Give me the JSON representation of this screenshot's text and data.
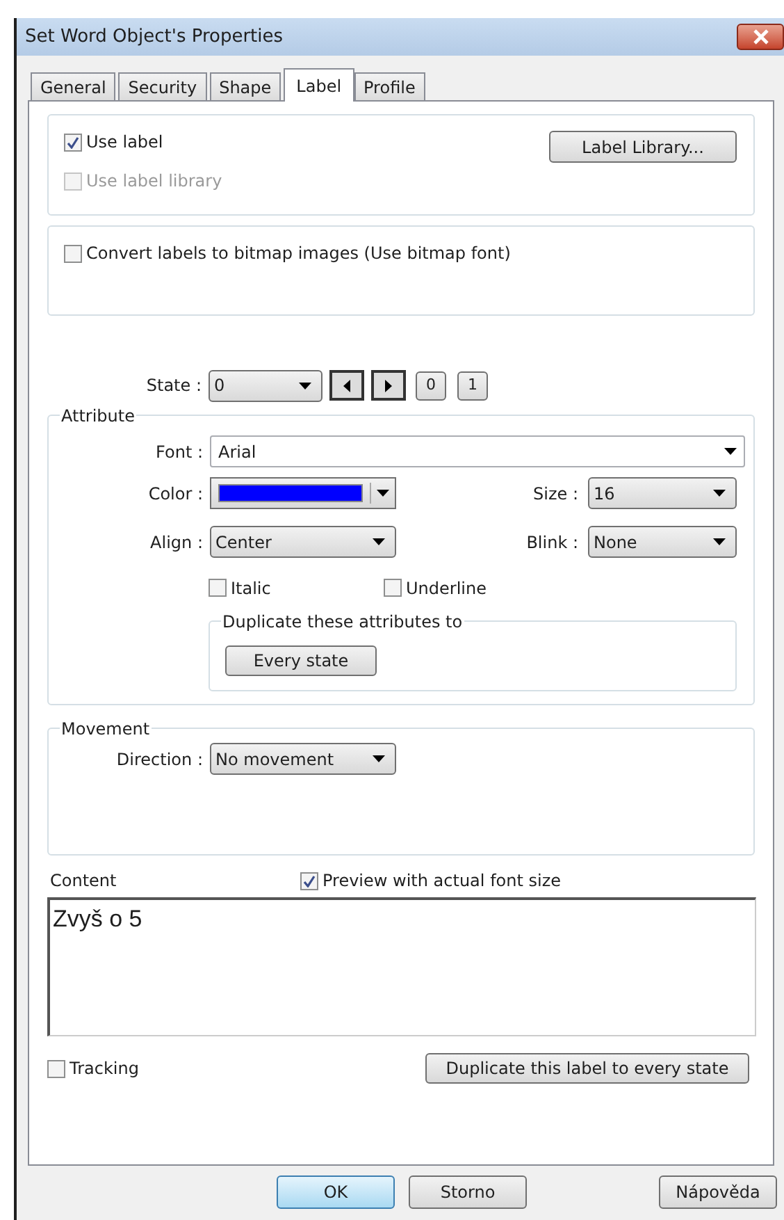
{
  "window": {
    "title": "Set Word Object's Properties"
  },
  "tabs": [
    {
      "label": "General",
      "selected": false
    },
    {
      "label": "Security",
      "selected": false
    },
    {
      "label": "Shape",
      "selected": false
    },
    {
      "label": "Label",
      "selected": true
    },
    {
      "label": "Profile",
      "selected": false
    }
  ],
  "label_group": {
    "use_label": {
      "label": "Use label",
      "checked": true,
      "disabled": false
    },
    "use_label_library": {
      "label": "Use label library",
      "checked": false,
      "disabled": true
    },
    "library_button": "Label Library..."
  },
  "bitmap": {
    "label": "Convert labels to bitmap images (Use bitmap font)",
    "checked": false,
    "disabled": false
  },
  "state": {
    "label": "State :",
    "value": "0",
    "buttons": [
      "0",
      "1"
    ]
  },
  "attribute": {
    "title": "Attribute",
    "font": {
      "label": "Font :",
      "value": "Arial"
    },
    "color": {
      "label": "Color :",
      "color": "#0000ff"
    },
    "size": {
      "label": "Size :",
      "value": "16"
    },
    "align": {
      "label": "Align :",
      "value": "Center"
    },
    "blink": {
      "label": "Blink :",
      "value": "None"
    },
    "italic": {
      "label": "Italic",
      "checked": false,
      "disabled": false
    },
    "underline": {
      "label": "Underline",
      "checked": false,
      "disabled": false
    },
    "duplicate": {
      "title": "Duplicate these attributes to",
      "button": "Every state"
    }
  },
  "movement": {
    "title": "Movement",
    "direction": {
      "label": "Direction :",
      "value": "No movement"
    }
  },
  "content": {
    "label": "Content",
    "preview": {
      "label": "Preview with actual font size",
      "checked": true,
      "disabled": false
    },
    "text": "Zvyš o 5"
  },
  "tracking": {
    "label": "Tracking",
    "checked": false,
    "disabled": false
  },
  "duplicate_button": "Duplicate this label to every state",
  "buttons": [
    {
      "label": "OK",
      "default": true
    },
    {
      "label": "Storno",
      "default": false
    },
    {
      "label": "Nápověda",
      "default": false
    }
  ]
}
